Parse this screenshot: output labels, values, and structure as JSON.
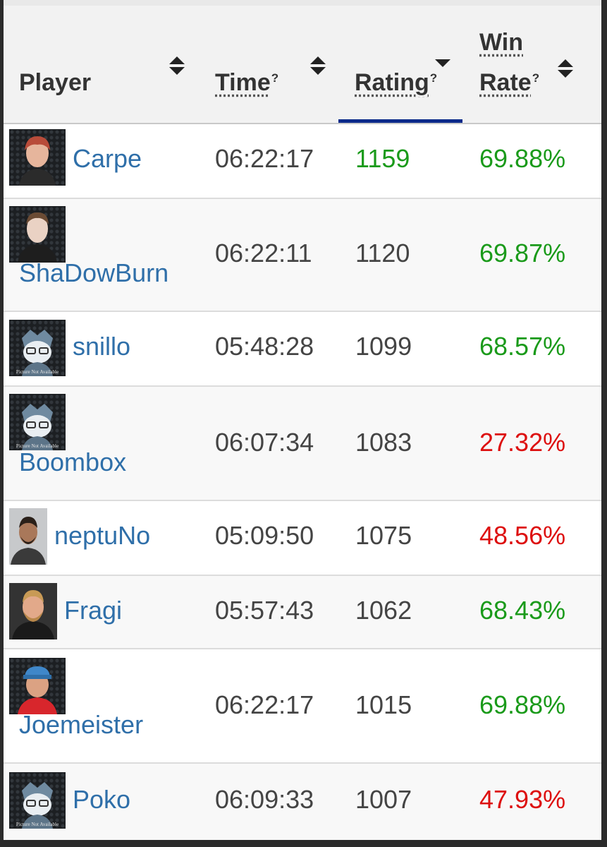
{
  "columns": {
    "player": "Player",
    "time": "Time",
    "rating": "Rating",
    "win_rate_line1": "Win",
    "win_rate_line2": "Rate",
    "help_mark": "?"
  },
  "placeholder_text": "Picture Not Available",
  "colors": {
    "link": "#2f6fa9",
    "positive": "#1a9a1a",
    "negative": "#dd0f0f",
    "active_sort_bar": "#0b2a8a"
  },
  "rows": [
    {
      "player": "Carpe",
      "time": "06:22:17",
      "rating": "1159",
      "win_rate": "69.88%",
      "win_status": "positive",
      "rating_status": "positive",
      "avatar": "photo"
    },
    {
      "player": "ShaDowBurn",
      "time": "06:22:11",
      "rating": "1120",
      "win_rate": "69.87%",
      "win_status": "positive",
      "rating_status": "neutral",
      "avatar": "photo"
    },
    {
      "player": "snillo",
      "time": "05:48:28",
      "rating": "1099",
      "win_rate": "68.57%",
      "win_status": "positive",
      "rating_status": "neutral",
      "avatar": "placeholder"
    },
    {
      "player": "Boombox",
      "time": "06:07:34",
      "rating": "1083",
      "win_rate": "27.32%",
      "win_status": "negative",
      "rating_status": "neutral",
      "avatar": "placeholder"
    },
    {
      "player": "neptuNo",
      "time": "05:09:50",
      "rating": "1075",
      "win_rate": "48.56%",
      "win_status": "negative",
      "rating_status": "neutral",
      "avatar": "photo"
    },
    {
      "player": "Fragi",
      "time": "05:57:43",
      "rating": "1062",
      "win_rate": "68.43%",
      "win_status": "positive",
      "rating_status": "neutral",
      "avatar": "photo"
    },
    {
      "player": "Joemeister",
      "time": "06:22:17",
      "rating": "1015",
      "win_rate": "69.88%",
      "win_status": "positive",
      "rating_status": "neutral",
      "avatar": "photo"
    },
    {
      "player": "Poko",
      "time": "06:09:33",
      "rating": "1007",
      "win_rate": "47.93%",
      "win_status": "negative",
      "rating_status": "neutral",
      "avatar": "placeholder"
    }
  ]
}
